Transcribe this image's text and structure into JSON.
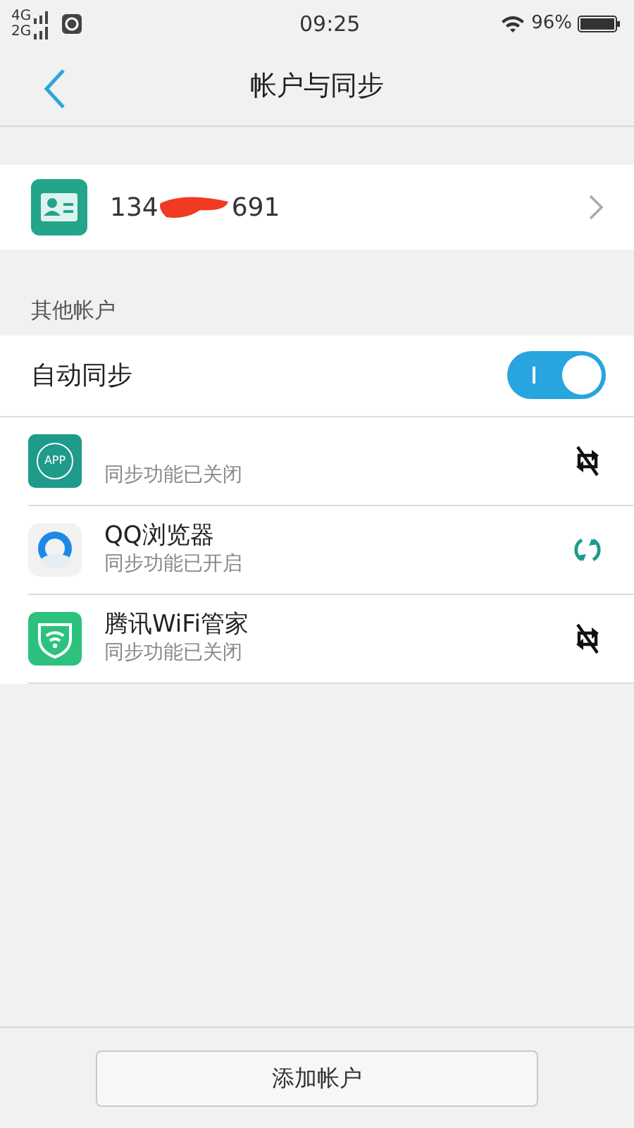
{
  "status_bar": {
    "networks": [
      "4G",
      "2G"
    ],
    "time": "09:25",
    "battery": "96%"
  },
  "header": {
    "title": "帐户与同步"
  },
  "account": {
    "number_start": "134",
    "number_end": "691",
    "redacted": true
  },
  "section_label": "其他帐户",
  "auto_sync": {
    "label": "自动同步",
    "on": true
  },
  "apps": [
    {
      "kind": "app",
      "icon_text": "APP",
      "status": "同步功能已关闭",
      "sync_on": false
    },
    {
      "kind": "browser",
      "name": "QQ浏览器",
      "status": "同步功能已开启",
      "sync_on": true
    },
    {
      "kind": "wifi",
      "name": "腾讯WiFi管家",
      "status": "同步功能已关闭",
      "sync_on": false
    }
  ],
  "add_button": "添加帐户"
}
